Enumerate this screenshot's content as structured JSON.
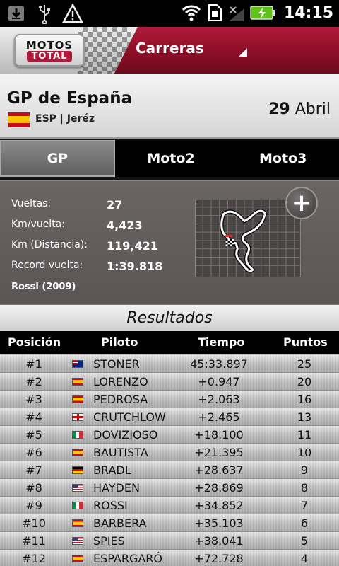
{
  "status_bar": {
    "time": "14:15",
    "left_icons": [
      "download-icon",
      "usb-icon",
      "warning-icon"
    ],
    "right_icons": [
      "wifi-icon",
      "sim-icon",
      "no-signal-icon",
      "battery-charging-icon"
    ]
  },
  "header": {
    "logo_top": "MOTOS",
    "logo_bottom": "TOTAL",
    "section": "Carreras"
  },
  "race": {
    "title": "GP de España",
    "subtitle": "ESP | Jeréz",
    "date_day": "29",
    "date_month": "Abril"
  },
  "tabs": [
    {
      "label": "GP",
      "active": true
    },
    {
      "label": "Moto2",
      "active": false
    },
    {
      "label": "Moto3",
      "active": false
    }
  ],
  "stats": {
    "laps_label": "Vueltas:",
    "laps_value": "27",
    "km_lap_label": "Km/vuelta:",
    "km_lap_value": "4,423",
    "km_total_label": "Km (Distancia):",
    "km_total_value": "119,421",
    "record_label": "Record vuelta:",
    "record_value": "1:39.818",
    "record_holder": "Rossi (2009)",
    "expand_icon": "plus-icon"
  },
  "results": {
    "title": "Resultados",
    "columns": [
      "Posición",
      "Piloto",
      "Tiempo",
      "Puntos"
    ],
    "rows": [
      {
        "pos": "#1",
        "flag": "au",
        "rider": "STONER",
        "time": "45:33.897",
        "points": "25"
      },
      {
        "pos": "#2",
        "flag": "es",
        "rider": "LORENZO",
        "time": "+0.947",
        "points": "20"
      },
      {
        "pos": "#3",
        "flag": "es",
        "rider": "PEDROSA",
        "time": "+2.063",
        "points": "16"
      },
      {
        "pos": "#4",
        "flag": "gb",
        "rider": "CRUTCHLOW",
        "time": "+2.465",
        "points": "13"
      },
      {
        "pos": "#5",
        "flag": "it",
        "rider": "DOVIZIOSO",
        "time": "+18.100",
        "points": "11"
      },
      {
        "pos": "#6",
        "flag": "es",
        "rider": "BAUTISTA",
        "time": "+21.395",
        "points": "10"
      },
      {
        "pos": "#7",
        "flag": "de",
        "rider": "BRADL",
        "time": "+28.637",
        "points": "9"
      },
      {
        "pos": "#8",
        "flag": "us",
        "rider": "HAYDEN",
        "time": "+28.869",
        "points": "8"
      },
      {
        "pos": "#9",
        "flag": "it",
        "rider": "ROSSI",
        "time": "+34.852",
        "points": "7"
      },
      {
        "pos": "#10",
        "flag": "es",
        "rider": "BARBERA",
        "time": "+35.103",
        "points": "6"
      },
      {
        "pos": "#11",
        "flag": "us",
        "rider": "SPIES",
        "time": "+38.041",
        "points": "5"
      },
      {
        "pos": "#12",
        "flag": "es",
        "rider": "ESPARGARÓ",
        "time": "+72.728",
        "points": "4"
      }
    ]
  },
  "colors": {
    "header_red": "#8b0f27",
    "panel_gray": "#5b5555",
    "tab_bg": "#000000"
  }
}
